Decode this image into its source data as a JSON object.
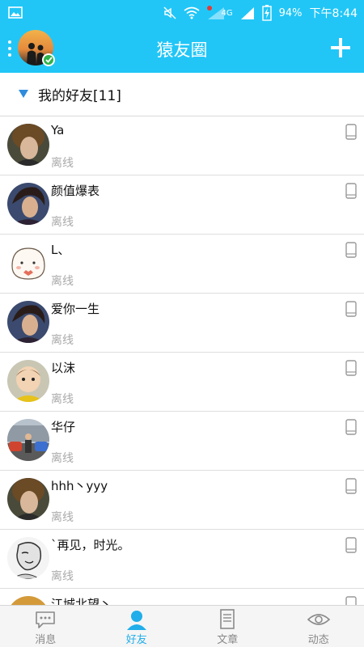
{
  "statusbar": {
    "battery": "94%",
    "network": "4G",
    "time": "下午8:44"
  },
  "appbar": {
    "title": "猿友圈"
  },
  "group": {
    "label": "我的好友[11]"
  },
  "friends": [
    {
      "name": "Ya",
      "status": "离线"
    },
    {
      "name": "颜值爆表",
      "status": "离线"
    },
    {
      "name": "L、",
      "status": "离线"
    },
    {
      "name": "爱你一生",
      "status": "离线"
    },
    {
      "name": "以沫",
      "status": "离线"
    },
    {
      "name": "华仔",
      "status": "离线"
    },
    {
      "name": "hhh丶yyy",
      "status": "离线"
    },
    {
      "name": "`再见，时光。",
      "status": "离线"
    },
    {
      "name": "江城北望丶",
      "status": ""
    }
  ],
  "nav": [
    {
      "label": "消息",
      "icon": "chat-bubble-icon",
      "active": false
    },
    {
      "label": "好友",
      "icon": "person-icon",
      "active": true
    },
    {
      "label": "文章",
      "icon": "document-icon",
      "active": false
    },
    {
      "label": "动态",
      "icon": "eye-icon",
      "active": false
    }
  ],
  "colors": {
    "accent": "#21c6f7",
    "nav_active": "#21aeea",
    "offline_text": "#aaaaaa"
  }
}
